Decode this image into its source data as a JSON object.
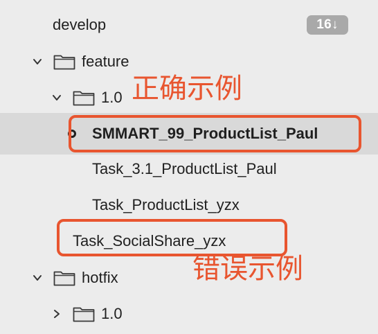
{
  "tree": {
    "develop": {
      "label": "develop",
      "badge": "16↓"
    },
    "feature": {
      "label": "feature"
    },
    "feature_1_0": {
      "label": "1.0"
    },
    "branches": [
      {
        "label": "SMMART_99_ProductList_Paul",
        "current": true
      },
      {
        "label": "Task_3.1_ProductList_Paul"
      },
      {
        "label": "Task_ProductList_yzx"
      },
      {
        "label": "Task_SocialShare_yzx"
      }
    ],
    "hotfix": {
      "label": "hotfix"
    },
    "hotfix_1_0": {
      "label": "1.0"
    }
  },
  "annotations": {
    "correct_label": "正确示例",
    "wrong_label": "错误示例",
    "color": "#e8552f"
  },
  "colors": {
    "background": "#ececec",
    "selected_row": "#d9d9d9",
    "badge": "#a9a9a9",
    "text": "#1f1f1f"
  }
}
